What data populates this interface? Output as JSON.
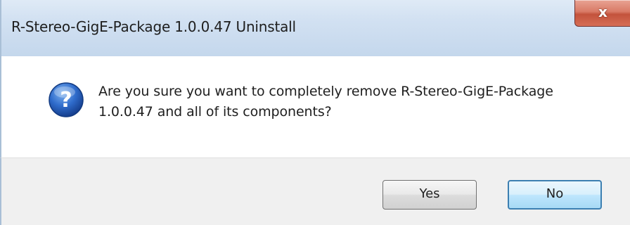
{
  "window": {
    "title": "R-Stereo-GigE-Package 1.0.0.47 Uninstall",
    "close_glyph": "x"
  },
  "dialog": {
    "icon": "question-icon",
    "message_line1": "Are you sure you want to completely remove R-Stereo-GigE-Package",
    "message_line2": "1.0.0.47 and all of its components?"
  },
  "buttons": {
    "yes_label": "Yes",
    "no_label": "No"
  },
  "colors": {
    "titlebar": "#d2e1f2",
    "close_button": "#c4533c",
    "footer": "#f0f0f0",
    "default_button_border": "#3c7fb1",
    "question_icon": "#1f57b5"
  }
}
